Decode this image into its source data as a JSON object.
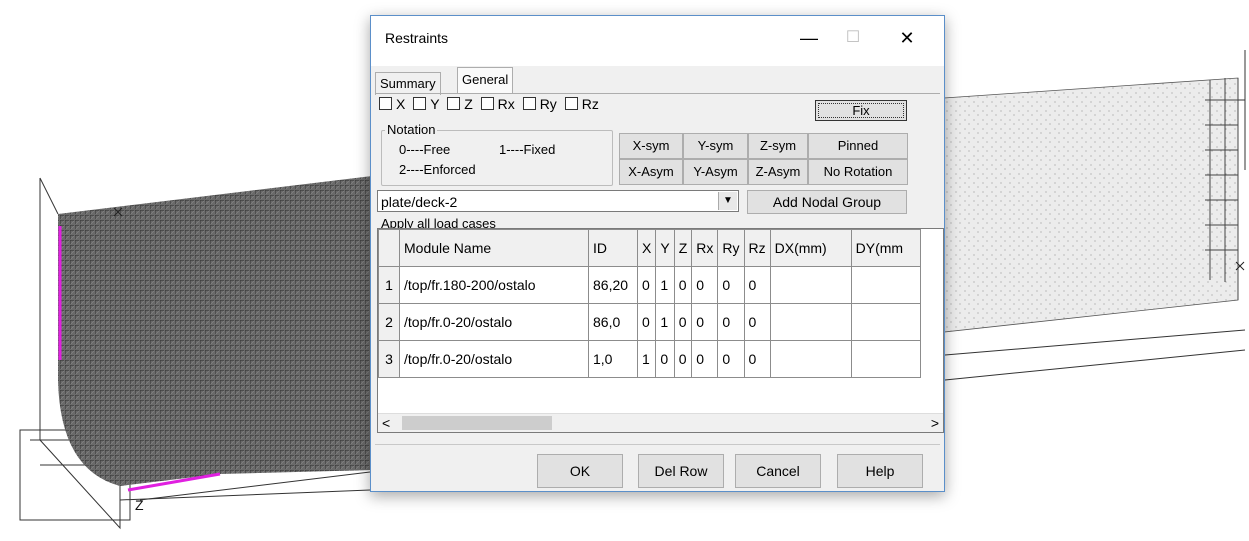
{
  "dialog": {
    "title": "Restraints",
    "controls": {
      "minimize": "—",
      "maximize": "☐",
      "close": "✕"
    },
    "tabs": [
      "Summary",
      "General"
    ],
    "active_tab": "General",
    "checkboxes": [
      "X",
      "Y",
      "Z",
      "Rx",
      "Ry",
      "Rz"
    ],
    "fix_label": "Fix",
    "notation": {
      "legend": "Notation",
      "free": "0----Free",
      "fixed": "1----Fixed",
      "enforced": "2----Enforced"
    },
    "buttons": {
      "x_sym": "X-sym",
      "y_sym": "Y-sym",
      "z_sym": "Z-sym",
      "pinned": "Pinned",
      "x_asym": "X-Asym",
      "y_asym": "Y-Asym",
      "z_asym": "Z-Asym",
      "no_rotation": "No Rotation",
      "add_nodal_group": "Add Nodal Group"
    },
    "group_select": {
      "value": "plate/deck-2"
    },
    "apply_all_label": "Apply all load cases",
    "table": {
      "headers": [
        "Module Name",
        "ID",
        "X",
        "Y",
        "Z",
        "Rx",
        "Ry",
        "Rz",
        "DX(mm)",
        "DY(mm"
      ],
      "rows": [
        {
          "n": "1",
          "module": "/top/fr.180-200/ostalo",
          "id": "86,20",
          "x": "0",
          "y": "1",
          "z": "0",
          "rx": "0",
          "ry": "0",
          "rz": "0"
        },
        {
          "n": "2",
          "module": "/top/fr.0-20/ostalo",
          "id": "86,0",
          "x": "0",
          "y": "1",
          "z": "0",
          "rx": "0",
          "ry": "0",
          "rz": "0"
        },
        {
          "n": "3",
          "module": "/top/fr.0-20/ostalo",
          "id": "1,0",
          "x": "1",
          "y": "0",
          "z": "0",
          "rx": "0",
          "ry": "0",
          "rz": "0"
        }
      ]
    },
    "footer": {
      "ok": "OK",
      "del_row": "Del Row",
      "cancel": "Cancel",
      "help": "Help"
    }
  },
  "viewport": {
    "axis_label": "Z",
    "mesh_color": "#4a4a4a",
    "highlight_color": "#e020e0"
  }
}
